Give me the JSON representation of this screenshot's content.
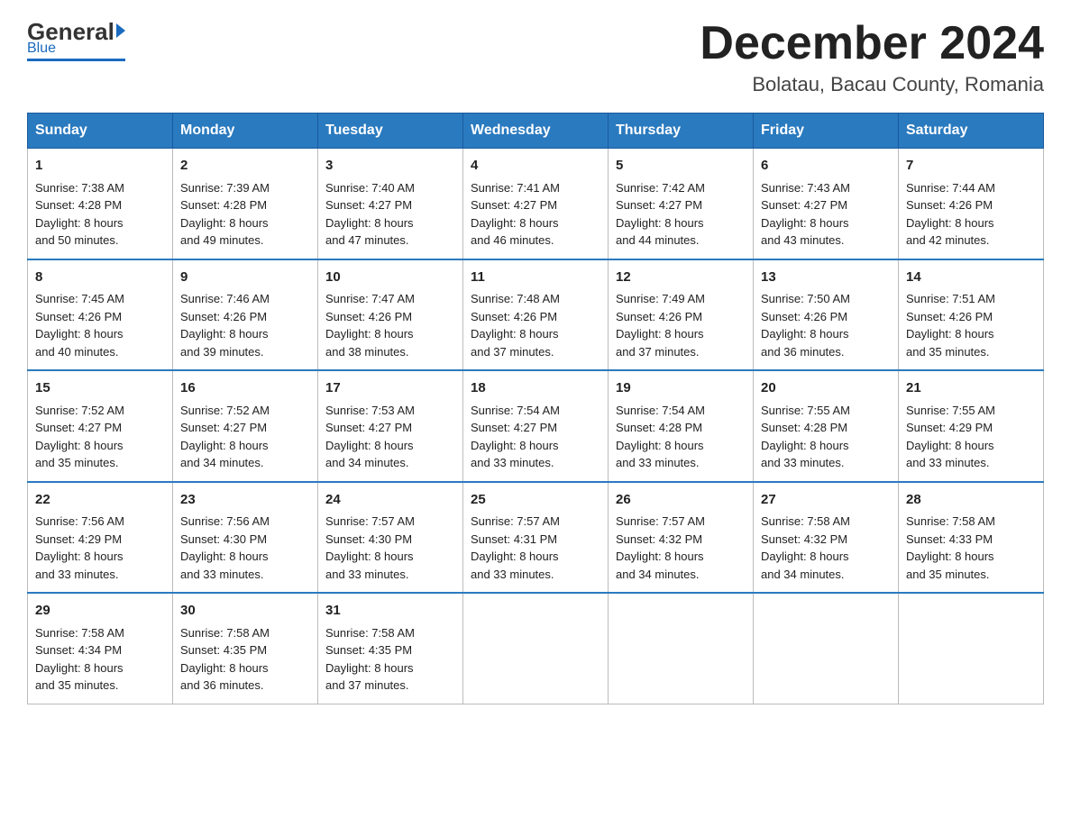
{
  "header": {
    "logo_general": "General",
    "logo_blue": "Blue",
    "month_title": "December 2024",
    "location": "Bolatau, Bacau County, Romania"
  },
  "days_of_week": [
    "Sunday",
    "Monday",
    "Tuesday",
    "Wednesday",
    "Thursday",
    "Friday",
    "Saturday"
  ],
  "weeks": [
    [
      {
        "day": "1",
        "sunrise": "7:38 AM",
        "sunset": "4:28 PM",
        "daylight": "8 hours and 50 minutes."
      },
      {
        "day": "2",
        "sunrise": "7:39 AM",
        "sunset": "4:28 PM",
        "daylight": "8 hours and 49 minutes."
      },
      {
        "day": "3",
        "sunrise": "7:40 AM",
        "sunset": "4:27 PM",
        "daylight": "8 hours and 47 minutes."
      },
      {
        "day": "4",
        "sunrise": "7:41 AM",
        "sunset": "4:27 PM",
        "daylight": "8 hours and 46 minutes."
      },
      {
        "day": "5",
        "sunrise": "7:42 AM",
        "sunset": "4:27 PM",
        "daylight": "8 hours and 44 minutes."
      },
      {
        "day": "6",
        "sunrise": "7:43 AM",
        "sunset": "4:27 PM",
        "daylight": "8 hours and 43 minutes."
      },
      {
        "day": "7",
        "sunrise": "7:44 AM",
        "sunset": "4:26 PM",
        "daylight": "8 hours and 42 minutes."
      }
    ],
    [
      {
        "day": "8",
        "sunrise": "7:45 AM",
        "sunset": "4:26 PM",
        "daylight": "8 hours and 40 minutes."
      },
      {
        "day": "9",
        "sunrise": "7:46 AM",
        "sunset": "4:26 PM",
        "daylight": "8 hours and 39 minutes."
      },
      {
        "day": "10",
        "sunrise": "7:47 AM",
        "sunset": "4:26 PM",
        "daylight": "8 hours and 38 minutes."
      },
      {
        "day": "11",
        "sunrise": "7:48 AM",
        "sunset": "4:26 PM",
        "daylight": "8 hours and 37 minutes."
      },
      {
        "day": "12",
        "sunrise": "7:49 AM",
        "sunset": "4:26 PM",
        "daylight": "8 hours and 37 minutes."
      },
      {
        "day": "13",
        "sunrise": "7:50 AM",
        "sunset": "4:26 PM",
        "daylight": "8 hours and 36 minutes."
      },
      {
        "day": "14",
        "sunrise": "7:51 AM",
        "sunset": "4:26 PM",
        "daylight": "8 hours and 35 minutes."
      }
    ],
    [
      {
        "day": "15",
        "sunrise": "7:52 AM",
        "sunset": "4:27 PM",
        "daylight": "8 hours and 35 minutes."
      },
      {
        "day": "16",
        "sunrise": "7:52 AM",
        "sunset": "4:27 PM",
        "daylight": "8 hours and 34 minutes."
      },
      {
        "day": "17",
        "sunrise": "7:53 AM",
        "sunset": "4:27 PM",
        "daylight": "8 hours and 34 minutes."
      },
      {
        "day": "18",
        "sunrise": "7:54 AM",
        "sunset": "4:27 PM",
        "daylight": "8 hours and 33 minutes."
      },
      {
        "day": "19",
        "sunrise": "7:54 AM",
        "sunset": "4:28 PM",
        "daylight": "8 hours and 33 minutes."
      },
      {
        "day": "20",
        "sunrise": "7:55 AM",
        "sunset": "4:28 PM",
        "daylight": "8 hours and 33 minutes."
      },
      {
        "day": "21",
        "sunrise": "7:55 AM",
        "sunset": "4:29 PM",
        "daylight": "8 hours and 33 minutes."
      }
    ],
    [
      {
        "day": "22",
        "sunrise": "7:56 AM",
        "sunset": "4:29 PM",
        "daylight": "8 hours and 33 minutes."
      },
      {
        "day": "23",
        "sunrise": "7:56 AM",
        "sunset": "4:30 PM",
        "daylight": "8 hours and 33 minutes."
      },
      {
        "day": "24",
        "sunrise": "7:57 AM",
        "sunset": "4:30 PM",
        "daylight": "8 hours and 33 minutes."
      },
      {
        "day": "25",
        "sunrise": "7:57 AM",
        "sunset": "4:31 PM",
        "daylight": "8 hours and 33 minutes."
      },
      {
        "day": "26",
        "sunrise": "7:57 AM",
        "sunset": "4:32 PM",
        "daylight": "8 hours and 34 minutes."
      },
      {
        "day": "27",
        "sunrise": "7:58 AM",
        "sunset": "4:32 PM",
        "daylight": "8 hours and 34 minutes."
      },
      {
        "day": "28",
        "sunrise": "7:58 AM",
        "sunset": "4:33 PM",
        "daylight": "8 hours and 35 minutes."
      }
    ],
    [
      {
        "day": "29",
        "sunrise": "7:58 AM",
        "sunset": "4:34 PM",
        "daylight": "8 hours and 35 minutes."
      },
      {
        "day": "30",
        "sunrise": "7:58 AM",
        "sunset": "4:35 PM",
        "daylight": "8 hours and 36 minutes."
      },
      {
        "day": "31",
        "sunrise": "7:58 AM",
        "sunset": "4:35 PM",
        "daylight": "8 hours and 37 minutes."
      },
      null,
      null,
      null,
      null
    ]
  ],
  "labels": {
    "sunrise": "Sunrise:",
    "sunset": "Sunset:",
    "daylight": "Daylight:"
  }
}
